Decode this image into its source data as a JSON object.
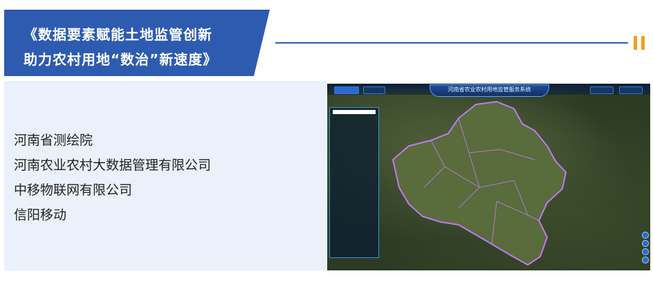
{
  "header": {
    "title_line1": "《数据要素赋能土地监管创新",
    "title_line2": "助力农村用地“数治”新速度》"
  },
  "organizations": [
    "河南省测绘院",
    "河南农业农村大数据管理有限公司",
    "中移物联网有限公司",
    "信阳移动"
  ],
  "screenshot": {
    "system_title": "河南省农业农村用地监管服务系统",
    "colors": {
      "boundary": "#c77dff",
      "ui_blue": "#2a6ad0",
      "accent_orange": "#f0a020",
      "banner_blue": "#2d5bb0"
    }
  }
}
